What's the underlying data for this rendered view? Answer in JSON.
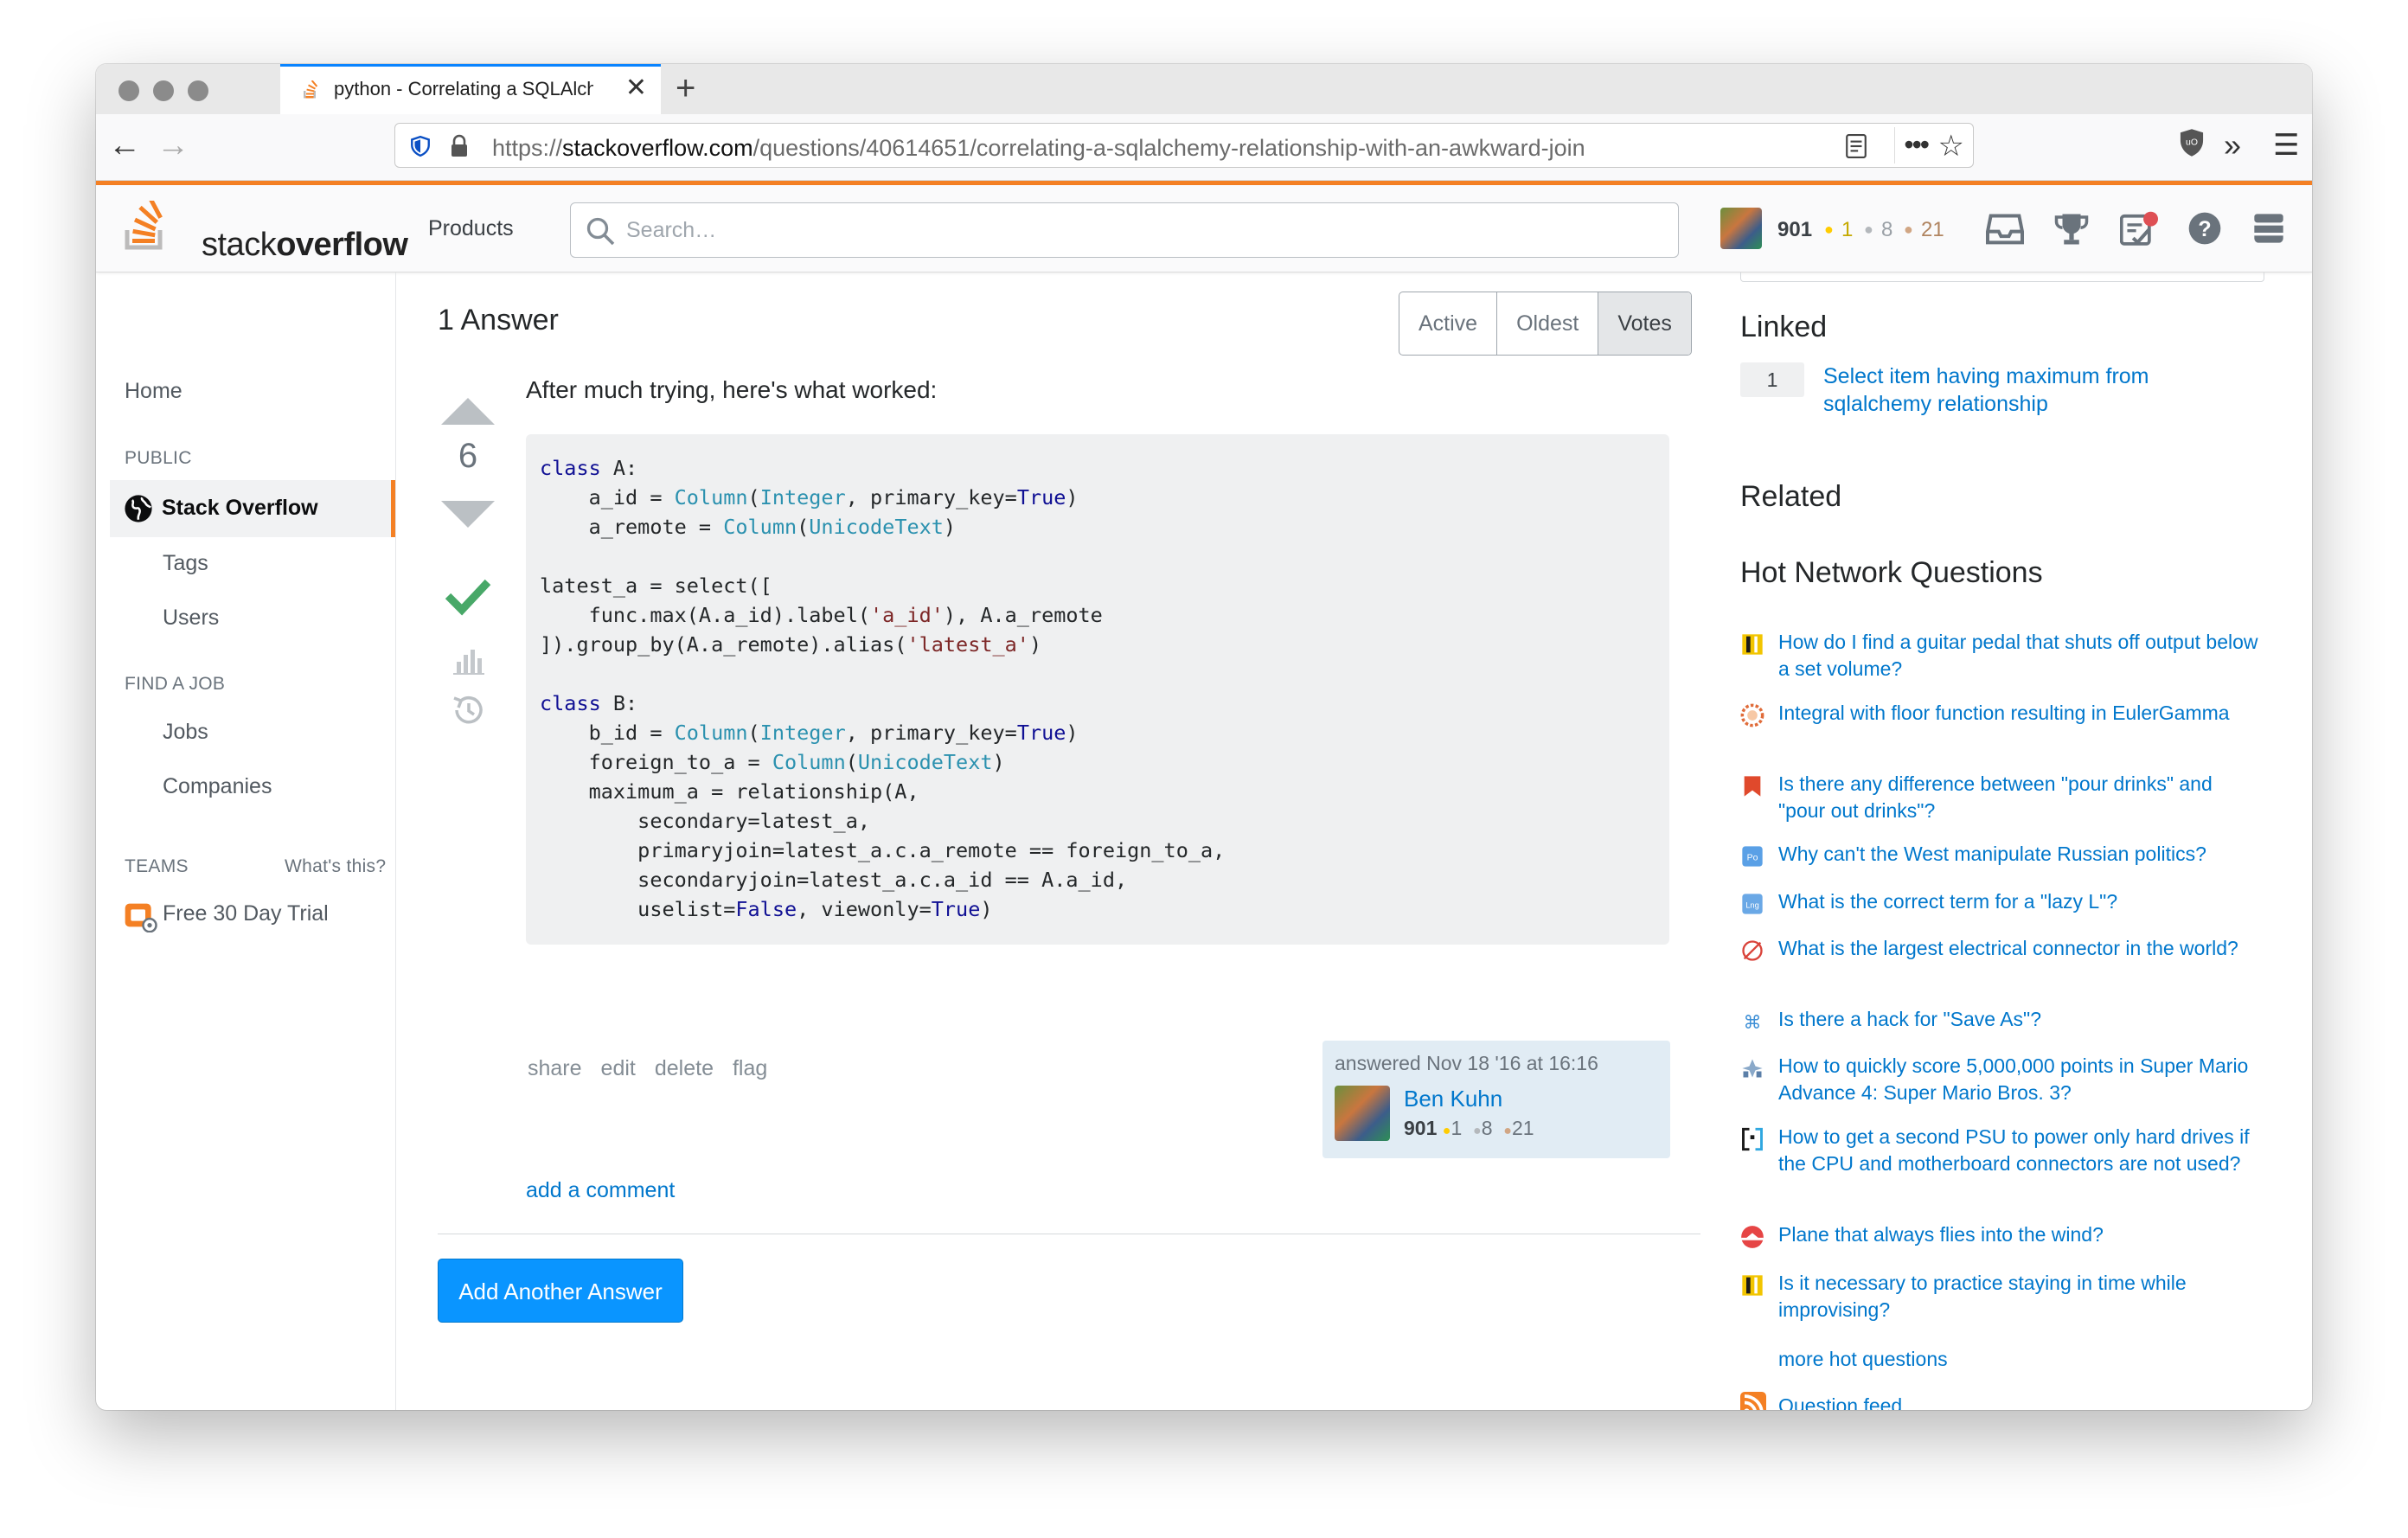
{
  "browser": {
    "tab_title": "python - Correlating a SQLAlchemy relationship with an awkward join",
    "url_scheme": "https://",
    "url_host": "stackoverflow.com",
    "url_path": "/questions/40614651/correlating-a-sqlalchemy-relationship-with-an-awkward-join"
  },
  "header": {
    "logo_light": "stack",
    "logo_bold": "overflow",
    "products": "Products",
    "search_placeholder": "Search…",
    "rep": "901",
    "gold": "1",
    "silver": "8",
    "bronze": "21",
    "colors": {
      "orange": "#f48024",
      "gold": "#ffcc01",
      "silver": "#b4b8bc",
      "bronze": "#d1a684",
      "inbox_dot": "#de4f54"
    }
  },
  "leftnav": {
    "home": "Home",
    "public": "PUBLIC",
    "stack_overflow": "Stack Overflow",
    "tags": "Tags",
    "users": "Users",
    "find_a_job": "FIND A JOB",
    "jobs": "Jobs",
    "companies": "Companies",
    "teams": "TEAMS",
    "whats_this": "What's this?",
    "free_trial": "Free 30 Day Trial"
  },
  "main": {
    "answers_heading": "1 Answer",
    "sort": [
      "Active",
      "Oldest",
      "Votes"
    ],
    "vote_count": "6",
    "answer_intro": "After much trying, here's what worked:",
    "post_menu": [
      "share",
      "edit",
      "delete",
      "flag"
    ],
    "answered": "answered Nov 18 '16 at 16:16",
    "author": "Ben Kuhn",
    "author_rep": "901",
    "author_gold": "1",
    "author_silver": "8",
    "author_bronze": "21",
    "add_comment": "add a comment",
    "add_answer": "Add Another Answer"
  },
  "sidebar": {
    "linked_heading": "Linked",
    "linked_count": "1",
    "linked_title": "Select item having maximum from sqlalchemy relationship",
    "related_heading": "Related",
    "hnq_heading": "Hot Network Questions",
    "hnq": [
      {
        "icon": "music-site-icon",
        "title": "How do I find a guitar pedal that shuts off output below a set volume?"
      },
      {
        "icon": "math-site-icon",
        "title": "Integral with floor function resulting in EulerGamma"
      },
      {
        "icon": "ell-site-icon",
        "title": "Is there any difference between \"pour drinks\" and \"pour out drinks\"?"
      },
      {
        "icon": "politics-site-icon",
        "title": "Why can't the West manipulate Russian politics?"
      },
      {
        "icon": "language-site-icon",
        "title": "What is the correct term for a \"lazy L\"?"
      },
      {
        "icon": "electronics-site-icon",
        "title": "What is the largest electrical connector in the world?"
      },
      {
        "icon": "apple-site-icon",
        "title": "Is there a hack for \"Save As\"?"
      },
      {
        "icon": "gaming-site-icon",
        "title": "How to quickly score 5,000,000 points in Super Mario Advance 4: Super Mario Bros. 3?"
      },
      {
        "icon": "superuser-site-icon",
        "title": "How to get a second PSU to power only hard drives if the CPU and motherboard connectors are not used?"
      },
      {
        "icon": "aviation-site-icon",
        "title": "Plane that always flies into the wind?"
      },
      {
        "icon": "music-site-icon",
        "title": "Is it necessary to practice staying in time while improvising?"
      }
    ],
    "more_hot": "more hot questions",
    "question_feed": "Question feed"
  }
}
